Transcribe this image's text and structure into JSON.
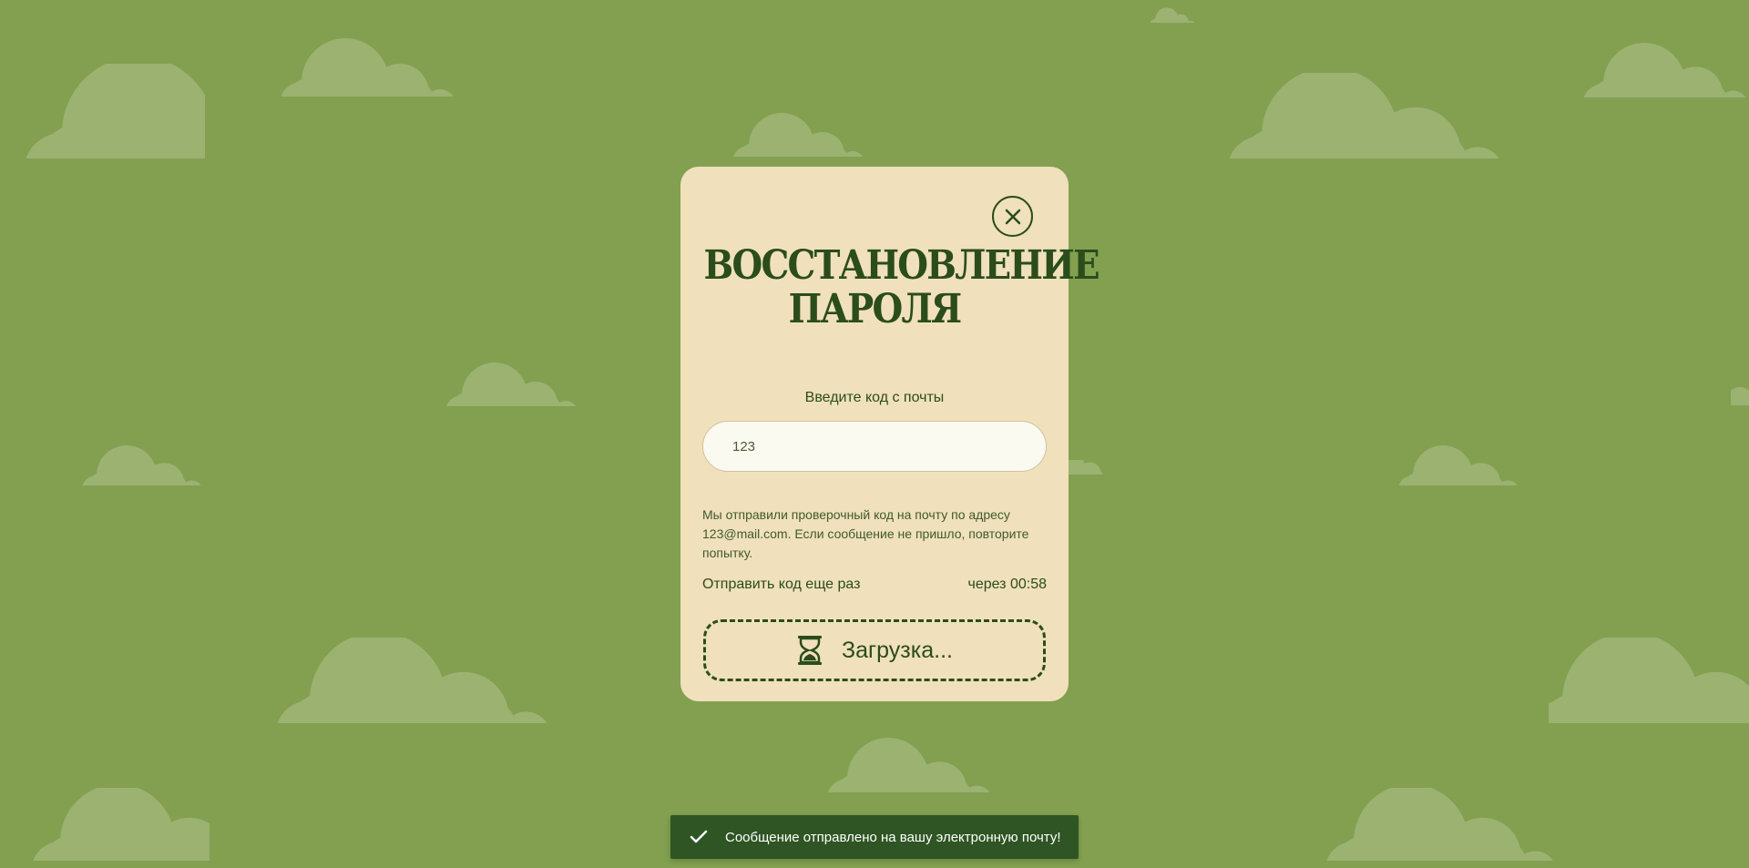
{
  "modal": {
    "title_line1": "ВОССТАНОВЛЕНИЕ",
    "title_line2": "ПАРОЛЯ",
    "close_icon": "close-icon",
    "code_label": "Введите код с почты",
    "code_value": "123",
    "info_text": "Мы отправили проверочный код на почту по адресу 123@mail.com. Если сообщение не пришло, повторите попытку.",
    "resend_label": "Отправить код еще раз",
    "resend_timer": "через 00:58",
    "submit_label": "Загрузка...",
    "submit_icon": "hourglass-icon"
  },
  "toast": {
    "icon": "check-icon",
    "message": "Сообщение отправлено на вашу электронную почту!"
  },
  "colors": {
    "background": "#82a050",
    "cloud": "#9bb271",
    "modal_bg": "#f0e0bc",
    "accent": "#2b4c1b",
    "input_bg": "#fbfaf0",
    "toast_bg": "#2e5523"
  }
}
